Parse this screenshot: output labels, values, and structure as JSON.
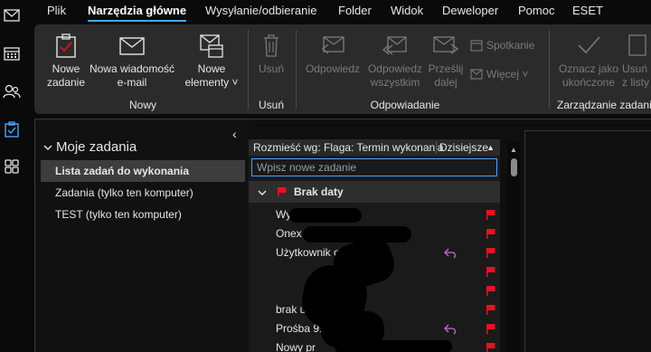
{
  "menu": {
    "tabs": [
      "Plik",
      "Narzędzia główne",
      "Wysyłanie/odbieranie",
      "Folder",
      "Widok",
      "Deweloper",
      "Pomoc",
      "ESET"
    ],
    "active_index": 1
  },
  "rail": {
    "icons": [
      "mail-icon",
      "calendar-icon",
      "people-icon",
      "tasks-icon",
      "apps-icon"
    ],
    "active": "tasks-icon"
  },
  "ribbon": {
    "new_task": [
      "Nowe",
      "zadanie"
    ],
    "new_email": [
      "Nowa wiadomość",
      "e-mail"
    ],
    "new_items": [
      "Nowe",
      "elementy ˅"
    ],
    "group_new": "Nowy",
    "delete": "Usuń",
    "group_delete": "Usuń",
    "reply": "Odpowiedz",
    "reply_all": [
      "Odpowiedz",
      "wszystkim"
    ],
    "forward": [
      "Prześlij",
      "dalej"
    ],
    "meeting": "Spotkanie",
    "more": "Więcej ˅",
    "group_respond": "Odpowiadanie",
    "mark_complete": [
      "Oznacz jako",
      "ukończone"
    ],
    "remove_from_list": [
      "Usuń",
      "z listy"
    ],
    "group_manage": "Zarządzanie zadaniem"
  },
  "nav": {
    "collapse_glyph": "‹",
    "header": "Moje zadania",
    "items": [
      {
        "label": "Lista zadań do wykonania",
        "selected": true
      },
      {
        "label": "Zadania (tylko ten komputer)",
        "selected": false
      },
      {
        "label": "TEST (tylko ten komputer)",
        "selected": false
      }
    ]
  },
  "list": {
    "header_sort": "Rozmieść wg: Flaga: Termin wykonania",
    "header_right": "Dzisiejsze",
    "header_arrow": "▲",
    "new_task_placeholder": "Wpisz nowe zadanie",
    "group_label": "Brak daty",
    "tasks": [
      {
        "text": "Wyjś",
        "reply": false
      },
      {
        "text": "Onex                         Podan...",
        "reply": false
      },
      {
        "text": "Użytkownik                     owicz c...",
        "reply": true
      },
      {
        "text": "",
        "reply": false
      },
      {
        "text": "",
        "reply": false
      },
      {
        "text": "brak u          Folderu",
        "reply": false
      },
      {
        "text": "Prośba                91777]",
        "reply": true
      },
      {
        "text": "Nowy pr",
        "reply": false
      }
    ]
  },
  "colors": {
    "accent": "#4aa3ff",
    "flag": "#e81123",
    "reply": "#c46ad8",
    "ribbon_bg": "#2b2b2b"
  }
}
